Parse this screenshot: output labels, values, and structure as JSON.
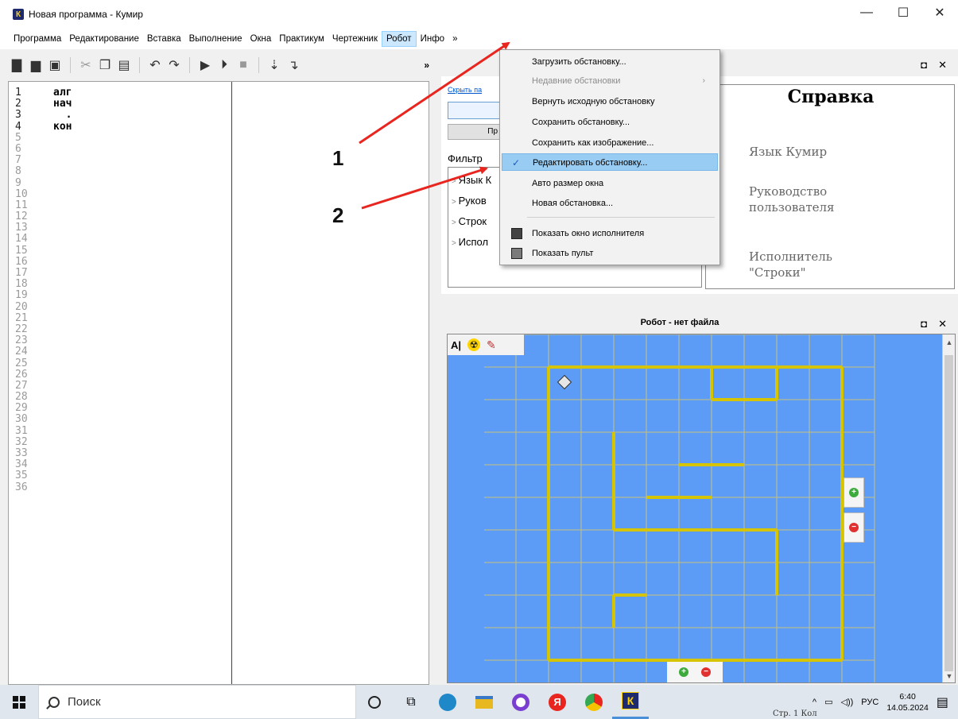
{
  "window": {
    "title": "Новая программа - Кумир",
    "app_icon_letter": "К",
    "minimize": "—",
    "maximize": "☐",
    "close": "✕"
  },
  "menu": [
    "Программа",
    "Редактирование",
    "Вставка",
    "Выполнение",
    "Окна",
    "Практикум",
    "Чертежник",
    "Робот",
    "Инфо",
    "»"
  ],
  "toolbar": {
    "more": "»"
  },
  "editor": {
    "lines": [
      "алг",
      "нач",
      "  .",
      "кон"
    ],
    "line_count": 36
  },
  "help": {
    "link": "Скрыть па",
    "button": "Пр",
    "filter_label": "Фильтр",
    "tree": [
      "Язык К",
      "Руков",
      "Строк",
      "Испол"
    ],
    "title": "Справка",
    "items": [
      "Язык Кумир",
      "Руководство пользователя",
      "Исполнитель \"Строки\""
    ]
  },
  "robot": {
    "title": "Робот - нет файла",
    "tool_text": "А|",
    "zoom_in": "+",
    "zoom_out": "−"
  },
  "robot_menu": {
    "items": [
      {
        "label": "Загрузить обстановку...",
        "disabled": false
      },
      {
        "label": "Недавние обстановки",
        "disabled": true,
        "submenu": true
      },
      {
        "label": "Вернуть исходную обстановку",
        "disabled": false
      },
      {
        "label": "Сохранить обстановку...",
        "disabled": false
      },
      {
        "label": "Сохранить как изображение...",
        "disabled": false
      },
      {
        "label": "Редактировать обстановку...",
        "checked": true,
        "highlighted": true
      },
      {
        "label": "Авто размер окна",
        "disabled": false
      },
      {
        "label": "Новая обстановка...",
        "disabled": false
      },
      {
        "label": "Показать окно исполнителя",
        "icon": "window-icon"
      },
      {
        "label": "Показать пульт",
        "icon": "remote-icon"
      }
    ],
    "check_glyph": "✓",
    "submenu_glyph": "›"
  },
  "annotations": [
    "1",
    "2"
  ],
  "taskbar": {
    "search_placeholder": "Поиск",
    "lang": "РУС",
    "time": "6:40",
    "date": "14.05.2024",
    "status_fragment": "Стр. 1 Кол"
  },
  "colors": {
    "robot_field": "#5c9cf6",
    "wall": "#d6c400",
    "grid": "#c9c07a",
    "highlight": "#99ccf2",
    "arrow": "#e8251e"
  }
}
